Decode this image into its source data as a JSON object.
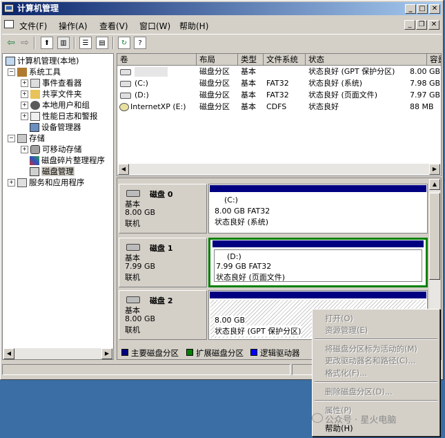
{
  "window": {
    "title": "计算机管理"
  },
  "menu": [
    "文件(F)",
    "操作(A)",
    "查看(V)",
    "窗口(W)",
    "帮助(H)"
  ],
  "tree": {
    "root": "计算机管理(本地)",
    "system_tools": "系统工具",
    "event_viewer": "事件查看器",
    "shared_folders": "共享文件夹",
    "local_users": "本地用户和组",
    "perf_logs": "性能日志和警报",
    "device_manager": "设备管理器",
    "storage": "存储",
    "removable": "可移动存储",
    "defrag": "磁盘碎片整理程序",
    "disk_mgmt": "磁盘管理",
    "services": "服务和应用程序"
  },
  "volume_list": {
    "headers": [
      "卷",
      "布局",
      "类型",
      "文件系统",
      "状态",
      "容量"
    ],
    "rows": [
      [
        "",
        "磁盘分区",
        "基本",
        "",
        "状态良好 (GPT 保护分区)",
        "8.00 GB"
      ],
      [
        "(C:)",
        "磁盘分区",
        "基本",
        "FAT32",
        "状态良好 (系统)",
        "7.98 GB"
      ],
      [
        "(D:)",
        "磁盘分区",
        "基本",
        "FAT32",
        "状态良好 (页面文件)",
        "7.97 GB"
      ],
      [
        "InternetXP (E:)",
        "磁盘分区",
        "基本",
        "CDFS",
        "状态良好",
        "88 MB"
      ]
    ]
  },
  "disks": [
    {
      "name": "磁盘 0",
      "type": "基本",
      "size": "8.00 GB",
      "state": "联机",
      "part_label": "(C:)",
      "part_size": "8.00 GB FAT32",
      "part_status": "状态良好 (系统)"
    },
    {
      "name": "磁盘 1",
      "type": "基本",
      "size": "7.99 GB",
      "state": "联机",
      "part_label": "(D:)",
      "part_size": "7.99 GB FAT32",
      "part_status": "状态良好 (页面文件)"
    },
    {
      "name": "磁盘 2",
      "type": "基本",
      "size": "8.00 GB",
      "state": "联机",
      "part_label": "",
      "part_size": "8.00 GB",
      "part_status": "状态良好 (GPT 保护分区)"
    }
  ],
  "legend": [
    {
      "label": "主要磁盘分区",
      "color": "#000080"
    },
    {
      "label": "扩展磁盘分区",
      "color": "#008000"
    },
    {
      "label": "逻辑驱动器",
      "color": "#0000ff"
    }
  ],
  "context_menu": {
    "open": "打开(O)",
    "explore": "资源管理(E)",
    "mark_active": "将磁盘分区标为活动的(M)",
    "change_letter": "更改驱动器名和路径(C)...",
    "format": "格式化(F)...",
    "delete": "删除磁盘分区(D)...",
    "properties": "属性(P)",
    "help": "帮助(H)"
  },
  "watermark": "公众号 · 星火电脑",
  "colors": {
    "title_start": "#0a246a",
    "title_end": "#a6caf0",
    "primary": "#000080",
    "extended": "#008000",
    "logical": "#0000ff"
  }
}
